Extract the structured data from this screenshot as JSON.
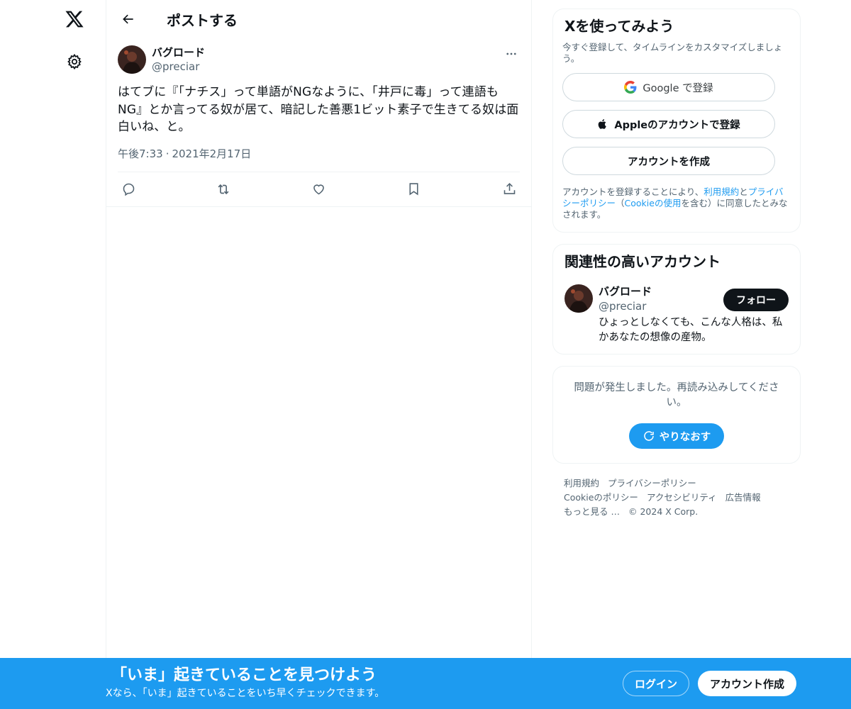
{
  "header": {
    "title": "ポストする"
  },
  "post": {
    "author_name": "バグロード",
    "author_handle": "@preciar",
    "text": "はてブに『「ナチス」って単語がNGなように、「井戸に毒」って連語も\nNG』とか言ってる奴が居て、暗記した善悪1ビット素子で生きてる奴は面\n白いね、と。",
    "time": "午後7:33",
    "separator": "·",
    "date": "2021年2月17日"
  },
  "signup": {
    "title": "Xを使ってみよう",
    "subtitle": "今すぐ登録して、タイムラインをカスタマイズしましょう。",
    "google_label": "Google で登録",
    "apple_label": "Appleのアカウントで登録",
    "create_label": "アカウントを作成",
    "terms_1": "アカウントを登録することにより、",
    "terms_link_tos": "利用規約",
    "terms_2": "と",
    "terms_link_privacy": "プライバシーポリシー",
    "terms_3": "（",
    "terms_link_cookie": "Cookieの使用",
    "terms_4": "を含む）に同意したとみなされます。"
  },
  "related": {
    "title": "関連性の高いアカウント",
    "name": "バグロード",
    "handle": "@preciar",
    "bio": "ひょっとしなくても、こんな人格は、私かあなたの想像の産物。",
    "follow_label": "フォロー"
  },
  "error": {
    "text": "問題が発生しました。再読み込みしてください。",
    "retry_label": "やりなおす"
  },
  "footer": {
    "links": [
      "利用規約",
      "プライバシーポリシー",
      "Cookieのポリシー",
      "アクセシビリティ",
      "広告情報",
      "もっと見る …"
    ],
    "copyright": "© 2024 X Corp."
  },
  "bottom_bar": {
    "title": "「いま」起きていることを見つけよう",
    "subtitle": "Xなら、「いま」起きていることをいち早くチェックできます。",
    "login_label": "ログイン",
    "create_label": "アカウント作成"
  },
  "colors": {
    "accent": "#1d9bf0",
    "text": "#0f1419",
    "muted": "#536471",
    "border": "#eff3f4"
  },
  "icons": [
    "x-logo-icon",
    "gear-icon",
    "back-arrow-icon",
    "more-icon",
    "reply-icon",
    "repost-icon",
    "like-icon",
    "bookmark-icon",
    "share-icon",
    "google-icon",
    "apple-icon",
    "refresh-icon"
  ]
}
